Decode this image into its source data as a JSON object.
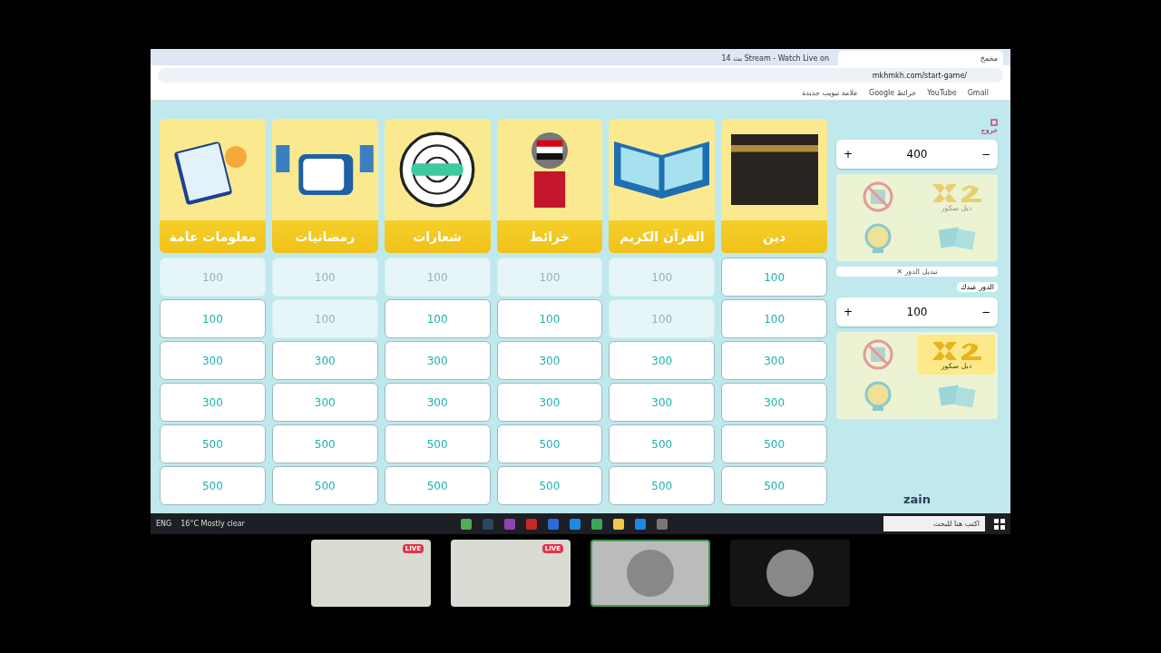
{
  "browser": {
    "tabs": [
      {
        "title": "بث 14 Stream - Watch Live on",
        "selected": false
      },
      {
        "title": "مخمخ",
        "selected": true
      }
    ],
    "url": "mkhmkh.com/start-game/",
    "bookmarks": [
      "علامة تبويب جديدة",
      "Google خرائط",
      "YouTube",
      "Gmail"
    ]
  },
  "board": {
    "categories": [
      {
        "name": "دين",
        "kind": "kaaba",
        "cells": [
          {
            "value": "100",
            "used": false
          },
          {
            "value": "100",
            "used": false
          },
          {
            "value": "300",
            "used": false
          },
          {
            "value": "300",
            "used": false
          },
          {
            "value": "500",
            "used": false
          },
          {
            "value": "500",
            "used": false
          }
        ]
      },
      {
        "name": "القرآن الكريم",
        "kind": "quran",
        "cells": [
          {
            "value": "100",
            "used": true
          },
          {
            "value": "100",
            "used": true
          },
          {
            "value": "300",
            "used": false
          },
          {
            "value": "300",
            "used": false
          },
          {
            "value": "500",
            "used": false
          },
          {
            "value": "500",
            "used": false
          }
        ]
      },
      {
        "name": "خرائط",
        "kind": "map",
        "cells": [
          {
            "value": "100",
            "used": true
          },
          {
            "value": "100",
            "used": false
          },
          {
            "value": "300",
            "used": false
          },
          {
            "value": "300",
            "used": false
          },
          {
            "value": "500",
            "used": false
          },
          {
            "value": "500",
            "used": false
          }
        ]
      },
      {
        "name": "شعارات",
        "kind": "logo",
        "cells": [
          {
            "value": "100",
            "used": true
          },
          {
            "value": "100",
            "used": false
          },
          {
            "value": "300",
            "used": false
          },
          {
            "value": "300",
            "used": false
          },
          {
            "value": "500",
            "used": false
          },
          {
            "value": "500",
            "used": false
          }
        ]
      },
      {
        "name": "رمضانيات",
        "kind": "tv",
        "cells": [
          {
            "value": "100",
            "used": true
          },
          {
            "value": "100",
            "used": true
          },
          {
            "value": "300",
            "used": false
          },
          {
            "value": "300",
            "used": false
          },
          {
            "value": "500",
            "used": false
          },
          {
            "value": "500",
            "used": false
          }
        ]
      },
      {
        "name": "معلومات عامة",
        "kind": "clipboard",
        "cells": [
          {
            "value": "100",
            "used": true
          },
          {
            "value": "100",
            "used": false
          },
          {
            "value": "300",
            "used": false
          },
          {
            "value": "300",
            "used": false
          },
          {
            "value": "500",
            "used": false
          },
          {
            "value": "500",
            "used": false
          }
        ]
      }
    ]
  },
  "sidebar": {
    "exit_label": "خروج",
    "switch_turn": "✕ تبديل الدور",
    "plus": "+",
    "minus": "−",
    "teams": [
      {
        "score": "400",
        "lifelines": [
          {
            "kind": "x2",
            "label": "دبل سكور",
            "active": false
          },
          {
            "kind": "block",
            "active": false
          },
          {
            "kind": "cards",
            "active": false
          },
          {
            "kind": "wheel",
            "active": false
          }
        ]
      },
      {
        "score": "100",
        "turn_label": "الدور عندك",
        "lifelines": [
          {
            "kind": "x2",
            "label": "دبل سكور",
            "active": true
          },
          {
            "kind": "block",
            "active": false
          },
          {
            "kind": "cards",
            "active": false
          },
          {
            "kind": "wheel",
            "active": false
          }
        ]
      }
    ],
    "sponsor": "zain"
  },
  "taskbar": {
    "search_placeholder": "اكتب هنا للبحث",
    "weather": "16°C  Mostly clear",
    "language": "ENG"
  },
  "stream_tiles": [
    {
      "kind": "screen",
      "badge": "LIVE",
      "selected": false
    },
    {
      "kind": "screen",
      "badge": "LIVE",
      "selected": false
    },
    {
      "kind": "avatar",
      "selected": true
    },
    {
      "kind": "avatar",
      "selected": false
    }
  ]
}
